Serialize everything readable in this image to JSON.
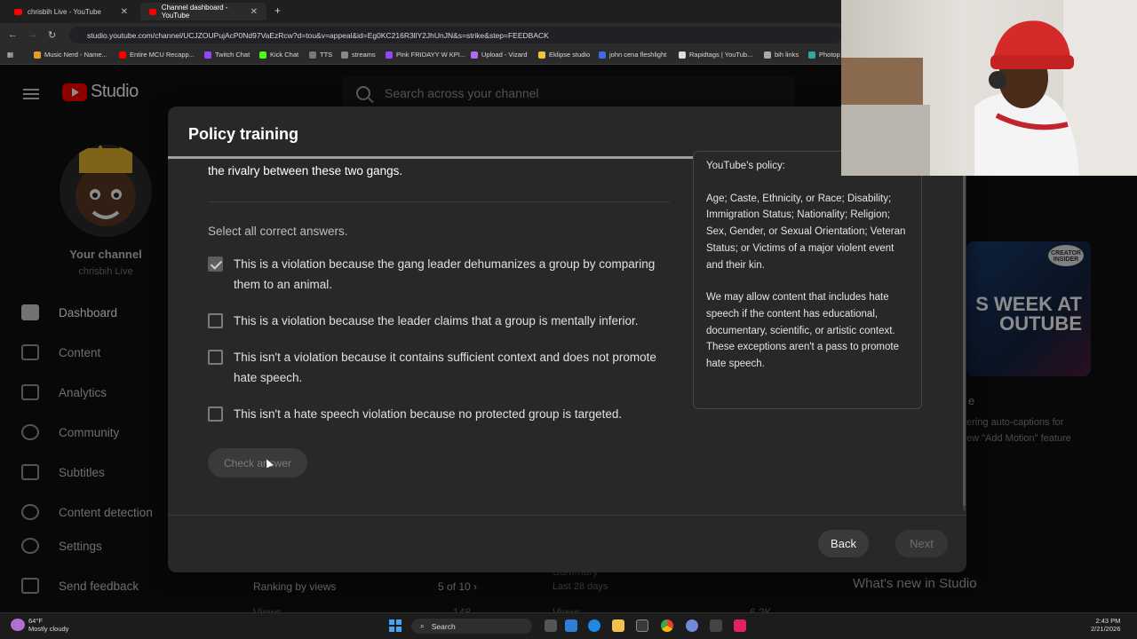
{
  "browser": {
    "tabs": [
      {
        "label": "chrisbih Live - YouTube",
        "active": false
      },
      {
        "label": "Channel dashboard - YouTube",
        "active": true
      }
    ],
    "new_tab": "+",
    "url": "studio.youtube.com/channel/UCJZOUPujAcP0Nd97VaEzRcw?d=tou&v=appeal&id=Eg0KC216R3llY2JhUnJN&s=strike&step=FEEDBACK",
    "bookmarks": [
      "Music Nerd - Name...",
      "Entire MCU Recapp...",
      "Twitch Chat",
      "Kick Chat",
      "TTS",
      "streams",
      "Pink FRIDAYY W KPI...",
      "Upload - Vizard",
      "Eklipse studio",
      "john cena fleshlight",
      "Rapidtags | YouTub...",
      "bih links",
      "Photop"
    ]
  },
  "studio": {
    "logo_text": "Studio",
    "search_placeholder": "Search across your channel",
    "channel_label": "Your channel",
    "channel_handle": "chrisbih Live",
    "nav": [
      {
        "label": "Dashboard",
        "icon": "dashboard-icon",
        "active": true
      },
      {
        "label": "Content",
        "icon": "content-icon"
      },
      {
        "label": "Analytics",
        "icon": "analytics-icon"
      },
      {
        "label": "Community",
        "icon": "community-icon"
      },
      {
        "label": "Subtitles",
        "icon": "subtitles-icon"
      },
      {
        "label": "Content detection",
        "icon": "copyright-icon"
      },
      {
        "label": "Settings",
        "icon": "gear-icon"
      },
      {
        "label": "Send feedback",
        "icon": "feedback-icon"
      }
    ],
    "background": {
      "thumb_title": "S WEEK AT\nOUTUBE",
      "thumb_badge": "CREATOR INSIDER",
      "card_text_1": "e",
      "card_text_2": "ering auto-captions for",
      "card_text_3": "ew \"Add Motion\" feature",
      "ranking_label": "Ranking by views",
      "ranking_value": "5 of 10",
      "summary_label": "Summary",
      "summary_sub": "Last 28 days",
      "views_left": "Views",
      "views_left_val": "148",
      "views_right": "Views",
      "views_right_val": "6.2K",
      "whats_new": "What's new in Studio"
    }
  },
  "dialog": {
    "title": "Policy training",
    "progress": 0.66,
    "question_tail": "the rivalry between these two gangs.",
    "select_label": "Select all correct answers.",
    "options": [
      {
        "text": "This is a violation because the gang leader dehumanizes a group by comparing them to an animal.",
        "checked": true
      },
      {
        "text": "This is a violation because the leader claims that a group is mentally inferior.",
        "checked": false
      },
      {
        "text": "This isn't a violation because it contains sufficient context and does not promote hate speech.",
        "checked": false
      },
      {
        "text": "This isn't a hate speech violation because no protected group is targeted.",
        "checked": false
      }
    ],
    "check_button": "Check answer",
    "policy": {
      "heading": "YouTube's policy:",
      "groups": "Age; Caste, Ethnicity, or Race; Disability; Immigration Status; Nationality; Religion; Sex, Gender, or Sexual Orientation; Veteran Status; or Victims of a major violent event and their kin.",
      "exception": "We may allow content that includes hate speech if the content has educational, documentary, scientific, or artistic context. These exceptions aren't a pass to promote hate speech."
    },
    "back_button": "Back",
    "next_button": "Next"
  },
  "taskbar": {
    "temp": "64°F",
    "weather": "Mostly cloudy",
    "search": "Search",
    "time": "2:43 PM",
    "date": "2/21/2026"
  }
}
